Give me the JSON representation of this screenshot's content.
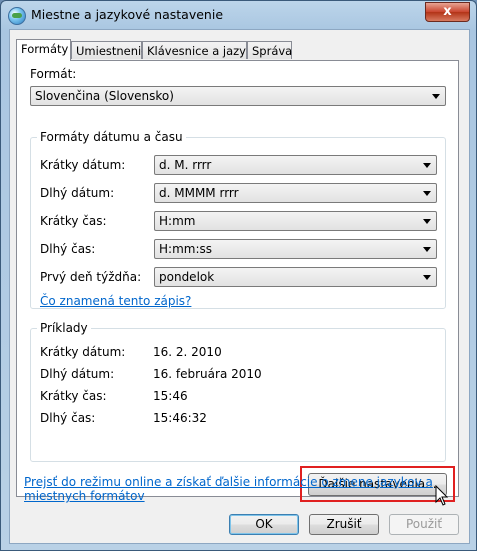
{
  "window": {
    "title": "Miestne a jazykové nastavenie",
    "close_label": "x"
  },
  "tabs": [
    {
      "label": "Formáty",
      "active": true
    },
    {
      "label": "Umiestnenie",
      "active": false
    },
    {
      "label": "Klávesnice a jazyky",
      "active": false
    },
    {
      "label": "Správa",
      "active": false
    }
  ],
  "format": {
    "label": "Formát:",
    "value": "Slovenčina (Slovensko)"
  },
  "datetime": {
    "group_title": "Formáty dátumu a času",
    "rows": [
      {
        "label": "Krátky dátum:",
        "value": "d. M. rrrr"
      },
      {
        "label": "Dlhý dátum:",
        "value": "d. MMMM rrrr"
      },
      {
        "label": "Krátky čas:",
        "value": "H:mm"
      },
      {
        "label": "Dlhý čas:",
        "value": "H:mm:ss"
      },
      {
        "label": "Prvý deň týždňa:",
        "value": "pondelok"
      }
    ],
    "notation_link": "Čo znamená tento zápis?"
  },
  "examples": {
    "group_title": "Príklady",
    "rows": [
      {
        "label": "Krátky dátum:",
        "value": "16. 2. 2010"
      },
      {
        "label": "Dlhý dátum:",
        "value": "16. februára 2010"
      },
      {
        "label": "Krátky čas:",
        "value": "15:46"
      },
      {
        "label": "Dlhý čas:",
        "value": "15:46:32"
      }
    ]
  },
  "more_settings_label": "Ďalšie nastavenia...",
  "online_link": "Prejsť do režimu online a získať ďalšie informácie o zmene jazykov a miestnych formátov",
  "footer": {
    "ok_label": "OK",
    "cancel_label": "Zrušiť",
    "apply_label": "Použiť"
  },
  "colors": {
    "highlight": "#e02020",
    "link": "#0066cc"
  }
}
